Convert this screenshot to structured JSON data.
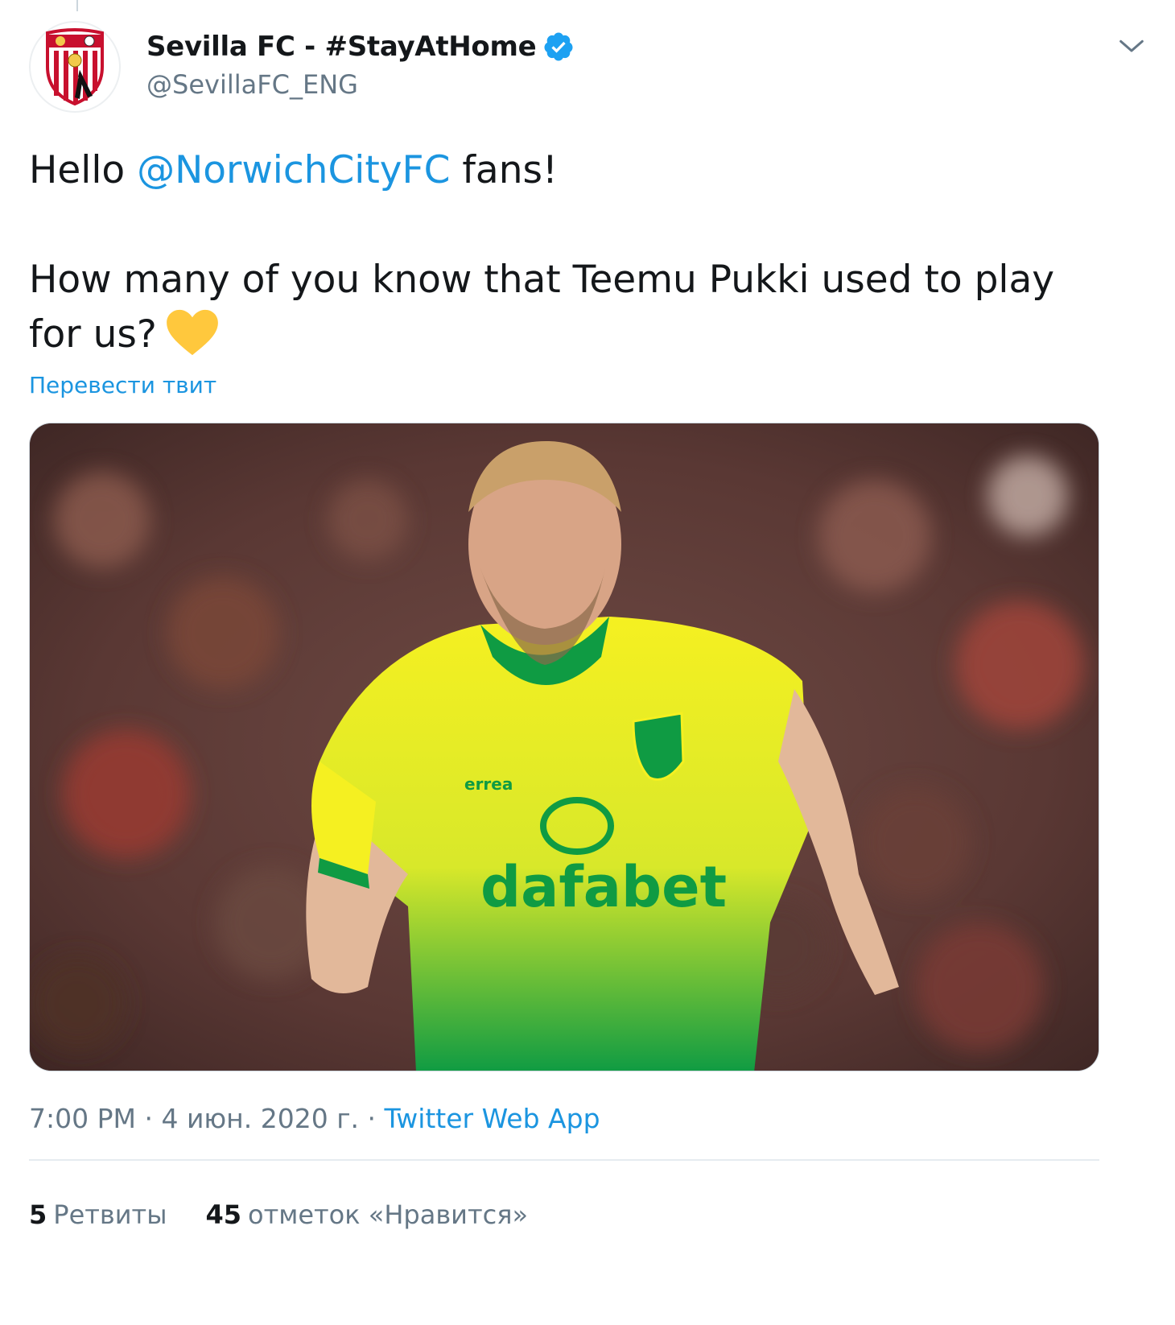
{
  "tweet": {
    "author": {
      "display_name": "Sevilla FC - #StayAtHome",
      "handle": "@SevillaFC_ENG",
      "verified": true,
      "avatar_icon": "sevilla-crest-icon"
    },
    "text": {
      "greeting_prefix": "Hello ",
      "mention": "@NorwichCityFC",
      "greeting_suffix": " fans!",
      "question": "How many of you know that Teemu Pukki used to play for us?",
      "emoji": "yellow-heart-icon"
    },
    "translate_label": "Перевести твит",
    "media": {
      "kit_sponsor_text": "dafabet",
      "kit_brand_text": "errea"
    },
    "meta": {
      "time": "7:00 PM",
      "separator": " · ",
      "date": "4 июн. 2020 г.",
      "source": "Twitter Web App"
    },
    "stats": {
      "retweets_count": "5",
      "retweets_label": "Ретвиты",
      "likes_count": "45",
      "likes_label": "отметок «Нравится»"
    }
  },
  "colors": {
    "link": "#1b95e0",
    "secondary_text": "#657786",
    "primary_text": "#14171a",
    "verified_badge": "#1da1f2",
    "heart": "#ffc83d",
    "kit_yellow": "#f5f021",
    "kit_green": "#0f9b43"
  }
}
